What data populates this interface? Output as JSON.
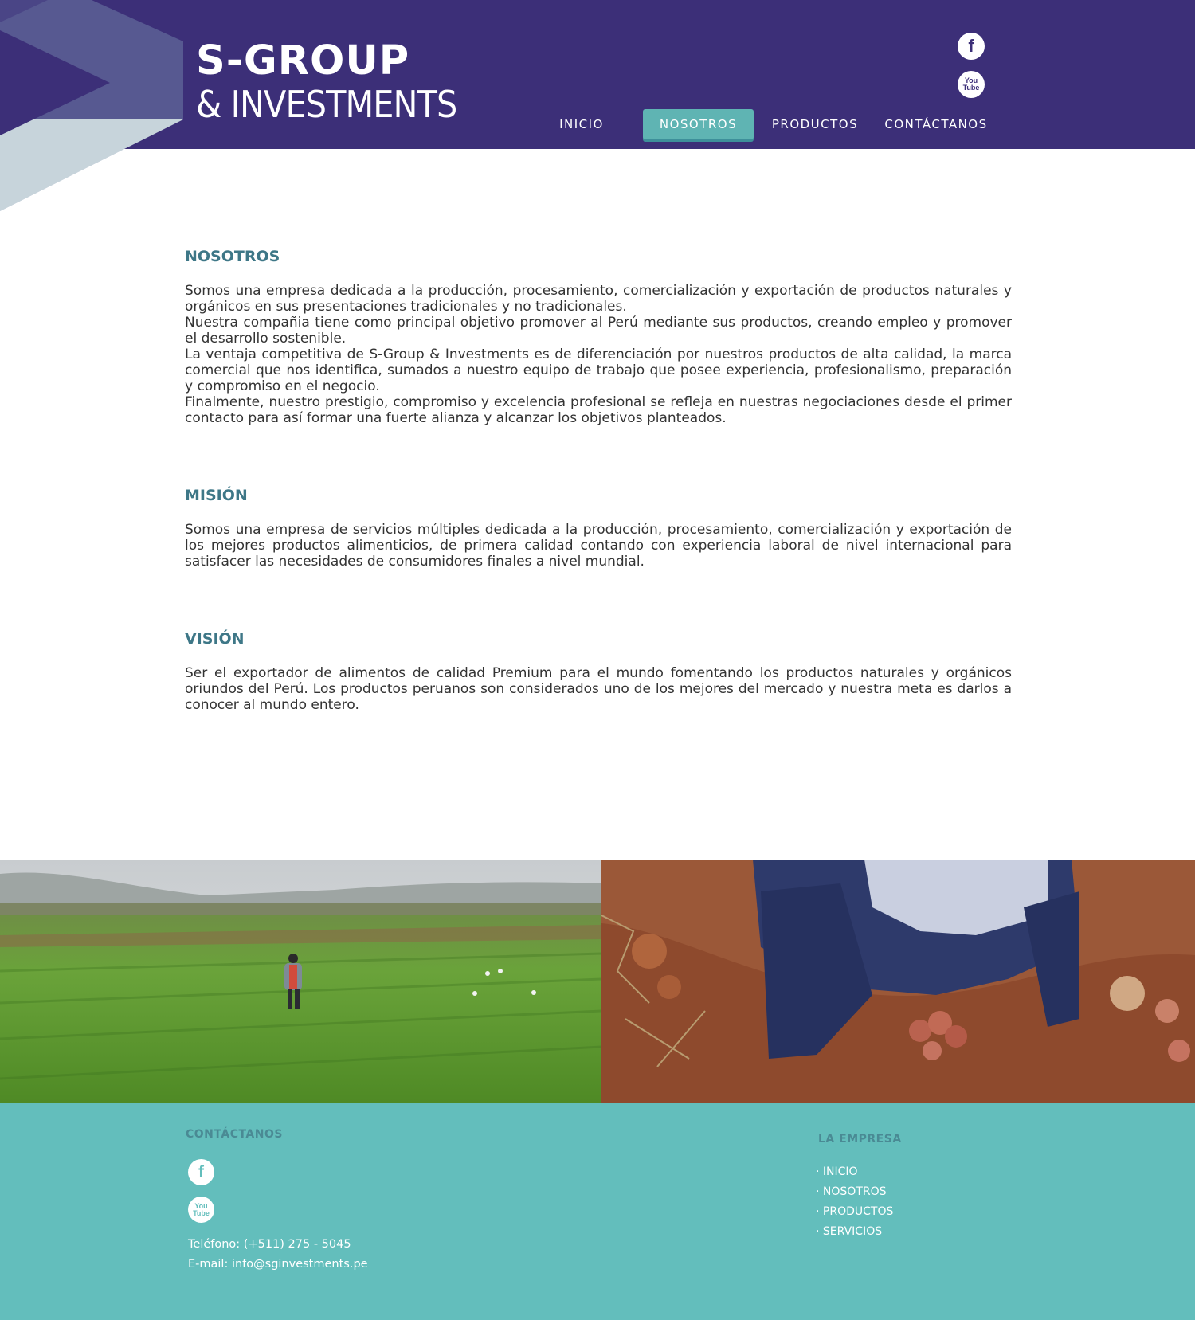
{
  "header": {
    "logo_line1": "S-GROUP",
    "logo_line2": "& INVESTMENTS",
    "nav": [
      "INICIO",
      "NOSOTROS",
      "PRODUCTOS",
      "CONTÁCTANOS"
    ],
    "active_nav": "NOSOTROS",
    "social_icons": [
      "facebook-icon",
      "youtube-icon"
    ]
  },
  "sections": {
    "nosotros": {
      "title": "NOSOTROS",
      "paragraphs": [
        "Somos una empresa dedicada a la producción, procesamiento, comercialización y exportación de productos naturales y orgánicos en sus presentaciones tradicionales y no tradicionales.",
        "Nuestra compañia tiene como principal objetivo promover al Perú mediante sus productos, creando empleo y promover el desarrollo sostenible.",
        "La ventaja competitiva de S-Group & Investments es de diferenciación por nuestros productos de alta calidad, la marca comercial que nos identifica, sumados a nuestro equipo de trabajo que posee experiencia, profesionalismo, preparación y compromiso en el negocio.",
        "Finalmente, nuestro prestigio, compromiso y excelencia profesional se refleja en nuestras negociaciones desde el primer contacto para así formar una fuerte alianza y alcanzar los objetivos planteados."
      ]
    },
    "mision": {
      "title": "MISIÓN",
      "text": "Somos una empresa de servicios múltiples dedicada a la producción, procesamiento, comercialización  y exportación de los mejores productos alimenticios, de primera calidad contando con experiencia laboral de nivel internacional para satisfacer las necesidades de  consumidores finales a nivel mundial."
    },
    "vision": {
      "title": "VISIÓN",
      "text": "Ser el exportador de alimentos de calidad Premium para el mundo fomentando los productos naturales y orgánicos oriundos del Perú. Los productos peruanos son considerados uno de los mejores del mercado y nuestra meta es darlos a conocer al mundo entero."
    }
  },
  "footer": {
    "contact_heading": "CONTÁCTANOS",
    "phone": "Teléfono: (+511) 275 - 5045",
    "email": "E-mail: info@sginvestments.pe",
    "company_heading": "LA EMPRESA",
    "links": [
      "· INICIO",
      "· NOSOTROS",
      "· PRODUCTOS",
      "· SERVICIOS"
    ]
  },
  "colors": {
    "header_bg": "#3c2f78",
    "accent": "#5fb4b3",
    "heading": "#3e7787",
    "footer_bg": "#63bebc"
  }
}
